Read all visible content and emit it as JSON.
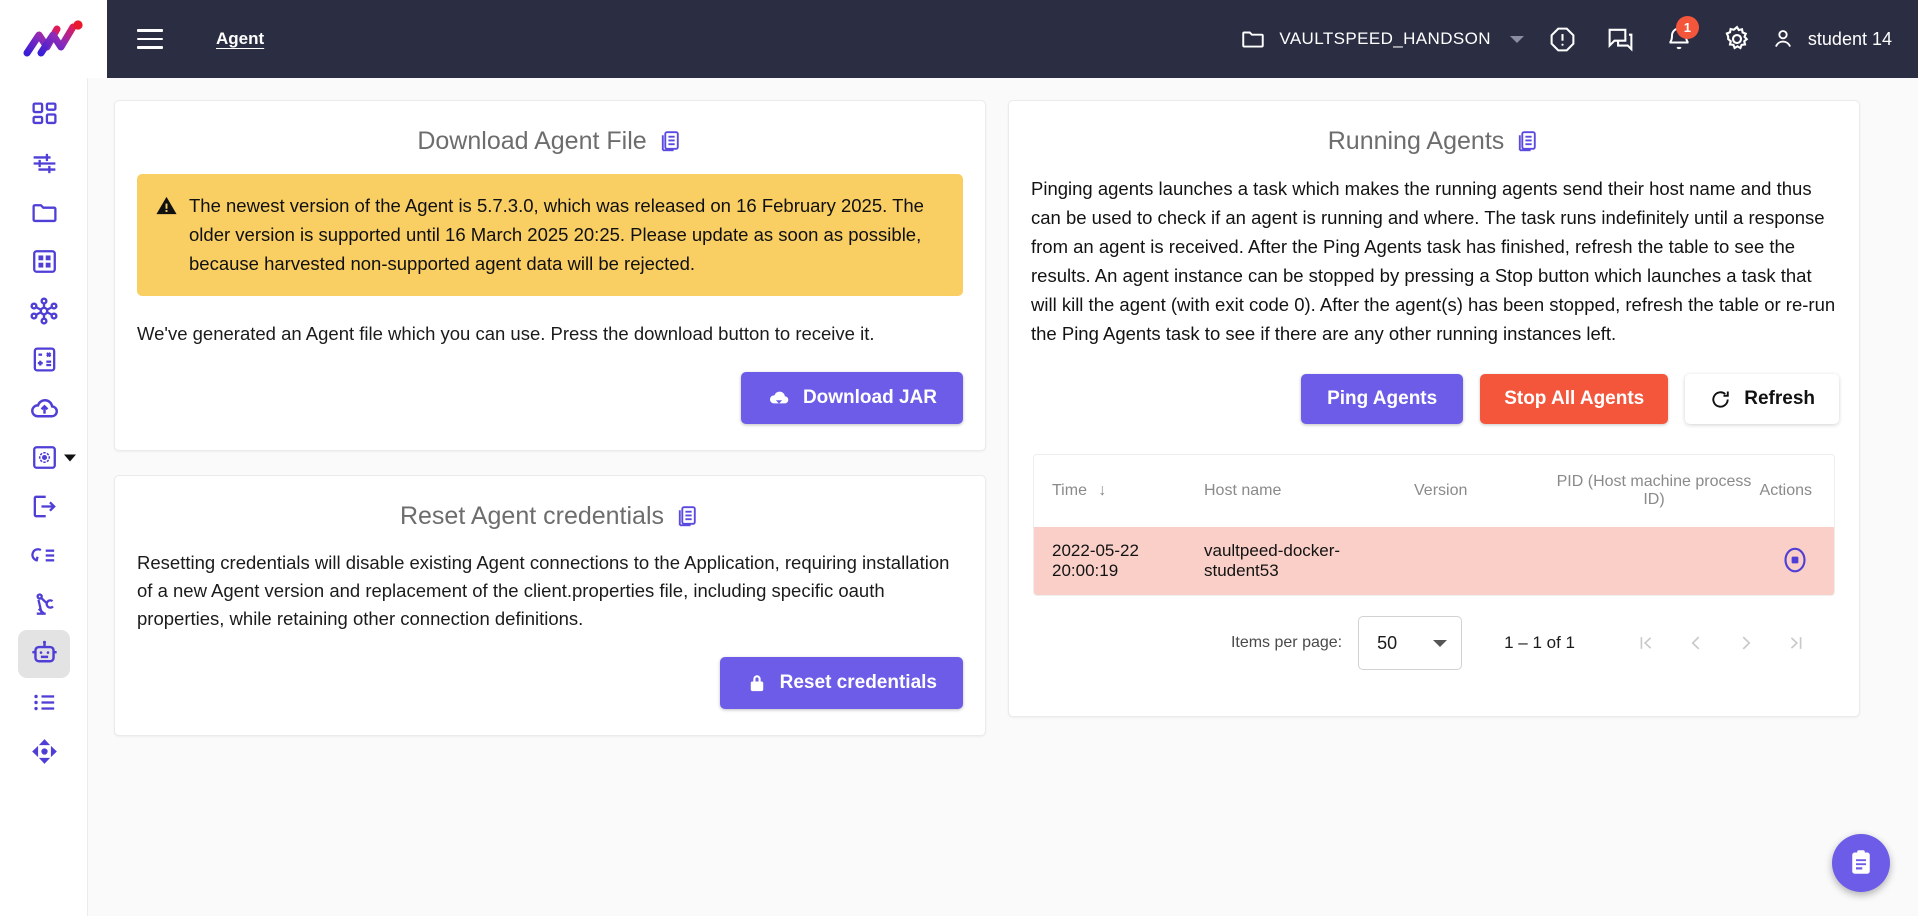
{
  "header": {
    "nav_title": "Agent",
    "menu_icon": "hamburger-icon",
    "project_name": "VAULTSPEED_HANDSON",
    "notification_count": "1",
    "user_name": "student 14",
    "icons": [
      "folder-icon",
      "alert-octagon-icon",
      "chat-icon",
      "bell-icon",
      "gear-icon",
      "person-icon"
    ]
  },
  "sidebar": {
    "items": [
      {
        "icon": "dashboard-grid-icon",
        "active": false
      },
      {
        "icon": "sliders-icon",
        "active": false
      },
      {
        "icon": "folder-icon",
        "active": false
      },
      {
        "icon": "table-grid-icon",
        "active": false
      },
      {
        "icon": "network-hub-icon",
        "active": false
      },
      {
        "icon": "calculator-icon",
        "active": false
      },
      {
        "icon": "cloud-upload-icon",
        "active": false
      },
      {
        "icon": "gear-box-icon",
        "active": false,
        "caret": true
      },
      {
        "icon": "export-arrow-icon",
        "active": false
      },
      {
        "icon": "refresh-list-icon",
        "active": false
      },
      {
        "icon": "robot-arm-icon",
        "active": false
      },
      {
        "icon": "agent-robot-icon",
        "active": true
      },
      {
        "icon": "list-icon",
        "active": false
      },
      {
        "icon": "move-arrows-icon",
        "active": false
      }
    ]
  },
  "download_card": {
    "title": "Download Agent File",
    "info_icon": "document-info-icon",
    "warning": "The newest version of the Agent is 5.7.3.0, which was released on 16 February 2025. The older version is supported until 16 March 2025 20:25. Please update as soon as possible, because harvested non-supported agent data will be rejected.",
    "warning_icon": "warning-triangle-icon",
    "body": "We've generated an Agent file which you can use. Press the download button to receive it.",
    "download_label": "Download JAR",
    "download_icon": "cloud-download-icon"
  },
  "reset_card": {
    "title": "Reset Agent credentials",
    "info_icon": "document-info-icon",
    "body": "Resetting credentials will disable existing Agent connections to the Application, requiring installation of a new Agent version and replacement of the client.properties file, including specific oauth properties, while retaining other connection definitions.",
    "reset_label": "Reset credentials",
    "reset_icon": "lock-icon"
  },
  "running_card": {
    "title": "Running Agents",
    "info_icon": "document-info-icon",
    "description": "Pinging agents launches a task which makes the running agents send their host name and thus can be used to check if an agent is running and where. The task runs indefinitely until a response from an agent is received. After the Ping Agents task has finished, refresh the table to see the results. An agent instance can be stopped by pressing a Stop button which launches a task that will kill the agent (with exit code 0). After the agent(s) has been stopped, refresh the table or re-run the Ping Agents task to see if there are any other running instances left.",
    "ping_label": "Ping Agents",
    "stop_all_label": "Stop All Agents",
    "refresh_label": "Refresh",
    "refresh_icon": "refresh-icon",
    "table": {
      "columns": {
        "time": "Time",
        "host": "Host name",
        "version": "Version",
        "pid": "PID (Host machine process ID)",
        "actions": "Actions"
      },
      "sort": "descending",
      "rows": [
        {
          "time": "2022-05-22 20:00:19",
          "host": "vaultpeed-docker-student53",
          "version": "",
          "pid": "",
          "action_icon": "stop-circle-icon"
        }
      ]
    },
    "paginator": {
      "items_per_page_label": "Items per page:",
      "items_per_page_value": "50",
      "range_label": "1 – 1 of 1",
      "first_icon": "first-page-icon",
      "prev_icon": "prev-page-icon",
      "next_icon": "next-page-icon",
      "last_icon": "last-page-icon"
    }
  },
  "fab": {
    "icon": "clipboard-tasks-icon"
  },
  "colors": {
    "accent": "#6c5ce7",
    "danger": "#f4563c",
    "warning_bg": "#f9cf64",
    "row_bg": "#f9cfc7",
    "topbar_bg": "#2b2d42"
  }
}
